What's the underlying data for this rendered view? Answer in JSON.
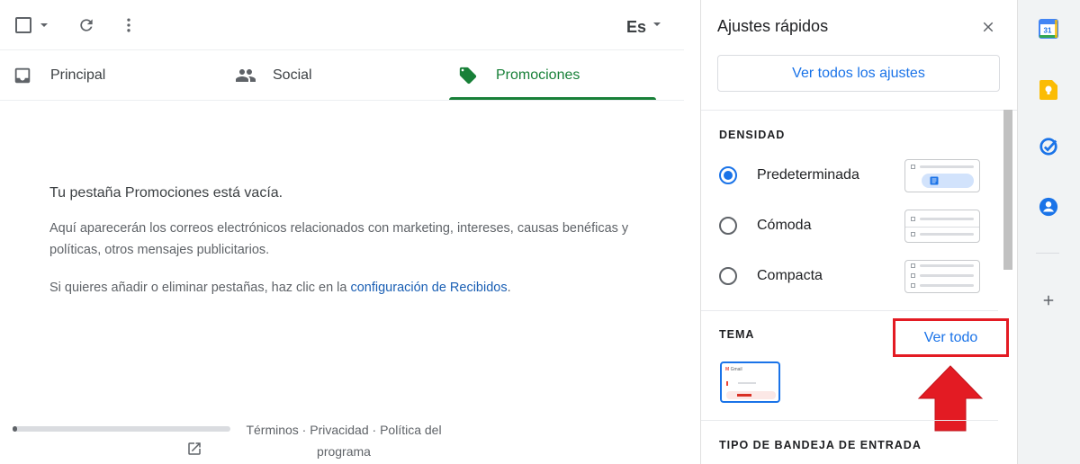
{
  "toolbar": {
    "language": "Es"
  },
  "tabs": [
    {
      "label": "Principal",
      "icon": "inbox-icon",
      "active": false
    },
    {
      "label": "Social",
      "icon": "people-icon",
      "active": false
    },
    {
      "label": "Promociones",
      "icon": "tag-icon",
      "active": true
    }
  ],
  "empty_state": {
    "title": "Tu pestaña Promociones está vacía.",
    "body": "Aquí aparecerán los correos electrónicos relacionados con marketing, intereses, causas benéficas y políticas, otros mensajes publicitarios.",
    "tabs_prefix": "Si quieres añadir o eliminar pestañas, haz clic en la ",
    "tabs_link": "configuración de Recibidos",
    "tabs_suffix": "."
  },
  "storage": {
    "used_fraction": 0.02
  },
  "footer": {
    "terms": "Términos",
    "separator": " · ",
    "privacy": "Privacidad",
    "policy": "Política del programa"
  },
  "quick_settings": {
    "title": "Ajustes rápidos",
    "see_all_button": "Ver todos los ajustes",
    "density": {
      "heading": "DENSIDAD",
      "options": [
        {
          "label": "Predeterminada",
          "selected": true
        },
        {
          "label": "Cómoda",
          "selected": false
        },
        {
          "label": "Compacta",
          "selected": false
        }
      ]
    },
    "theme": {
      "heading": "TEMA",
      "see_all": "Ver todo",
      "thumb_brand": "Gmail"
    },
    "inbox_type": {
      "heading": "TIPO DE BANDEJA DE ENTRADA"
    }
  },
  "side_rail": {
    "calendar_day": "31",
    "items": [
      "calendar-icon",
      "keep-icon",
      "tasks-icon",
      "contacts-icon",
      "add-icon"
    ]
  },
  "colors": {
    "active_tab": "#188038",
    "accent_blue": "#1a73e8",
    "highlight_red": "#e31b23"
  }
}
